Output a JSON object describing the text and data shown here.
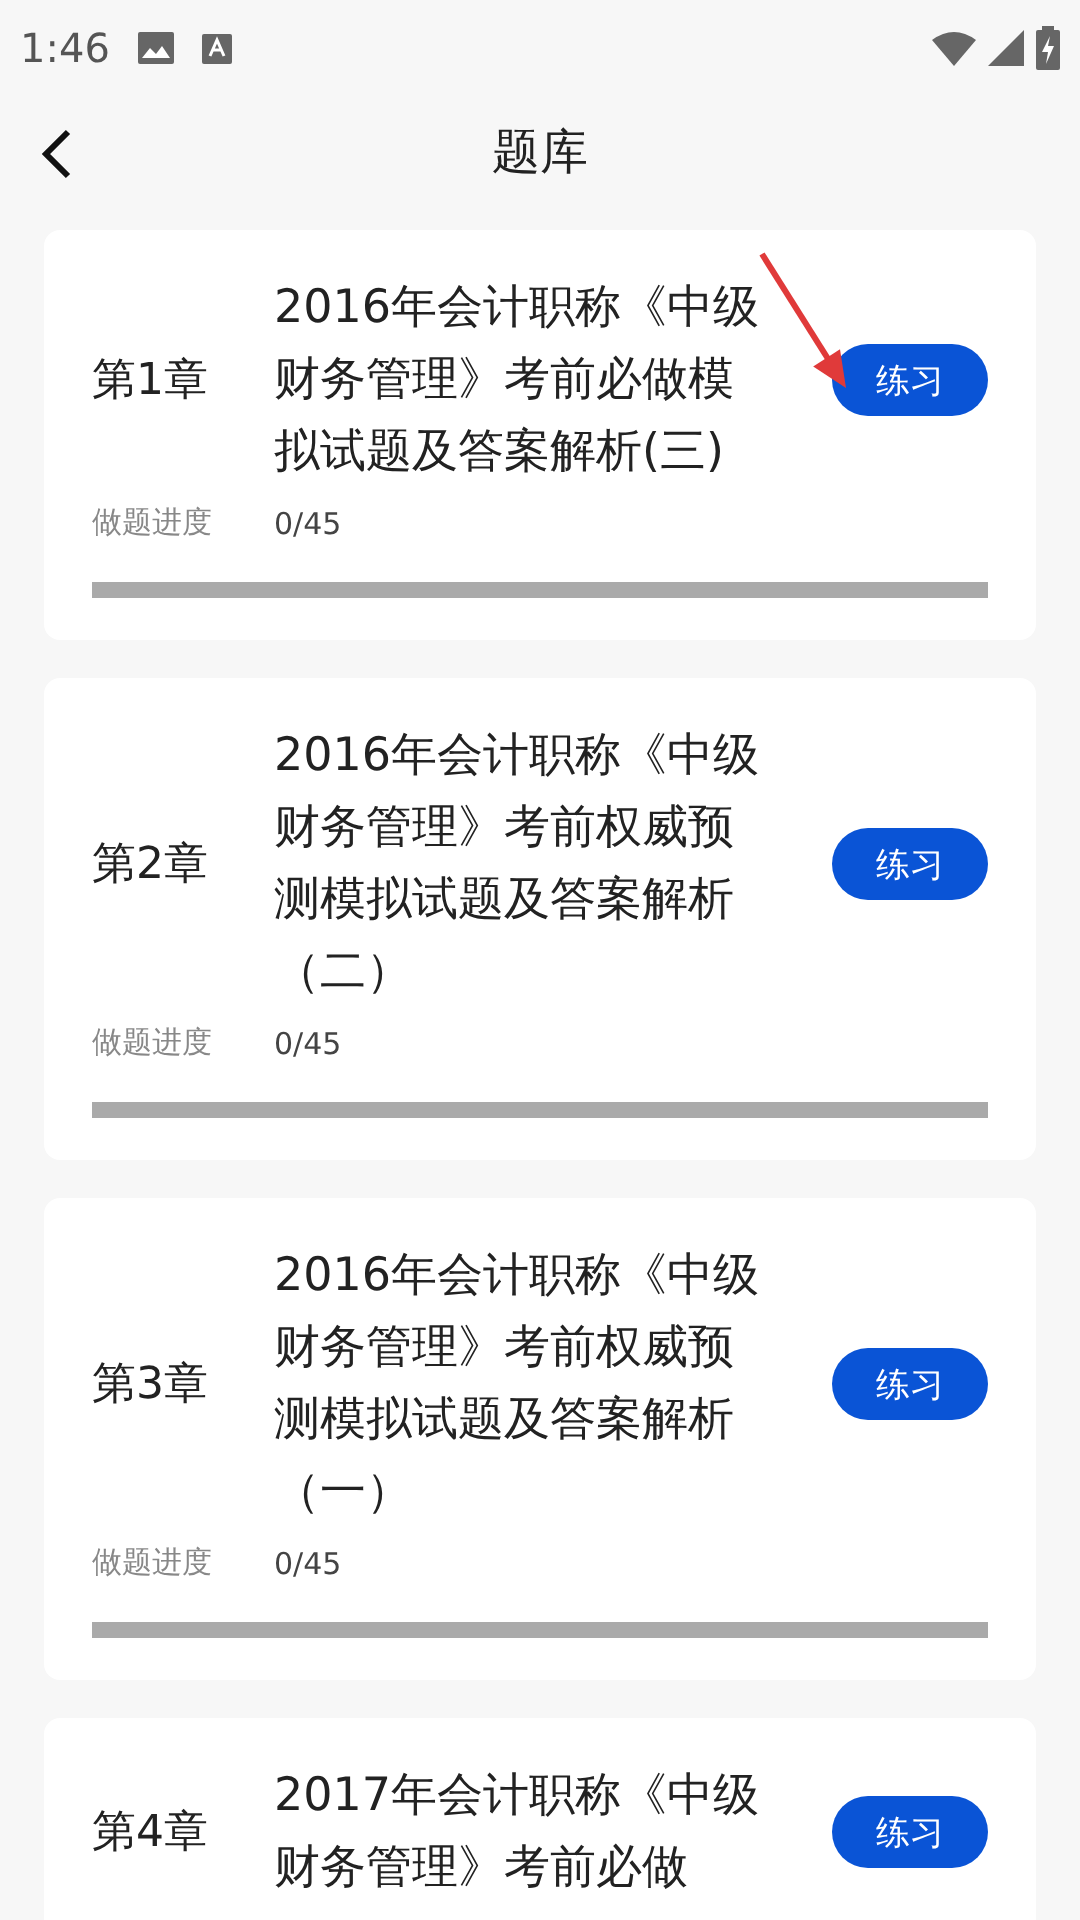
{
  "status_bar": {
    "time": "1:46"
  },
  "header": {
    "title": "题库"
  },
  "chapters": [
    {
      "chapter": "第1章",
      "title": "2016年会计职称《中级财务管理》考前必做模拟试题及答案解析(三)",
      "progress_label": "做题进度",
      "progress": "0/45",
      "level": 0,
      "button": "练习"
    },
    {
      "chapter": "第2章",
      "title": "2016年会计职称《中级财务管理》考前权威预测模拟试题及答案解析（二）",
      "progress_label": "做题进度",
      "progress": "0/45",
      "level": 0,
      "button": "练习"
    },
    {
      "chapter": "第3章",
      "title": "2016年会计职称《中级财务管理》考前权威预测模拟试题及答案解析（一）",
      "progress_label": "做题进度",
      "progress": "0/45",
      "level": 0,
      "button": "练习"
    },
    {
      "chapter": "第4章",
      "title": "2017年会计职称《中级财务管理》考前必做",
      "button": "练习"
    }
  ]
}
